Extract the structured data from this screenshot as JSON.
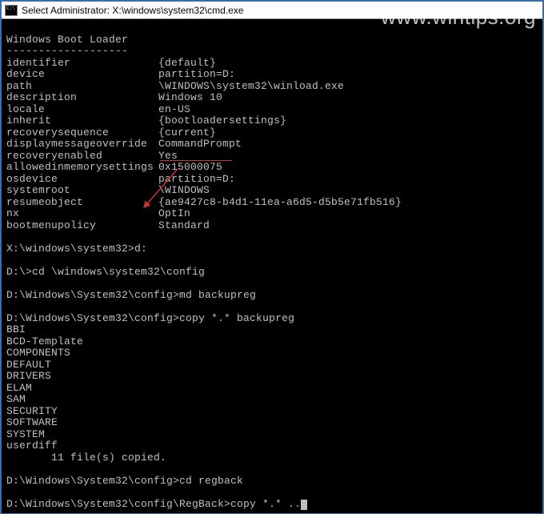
{
  "window": {
    "title": "Select Administrator: X:\\windows\\system32\\cmd.exe"
  },
  "watermark": "www.wintips.org",
  "terminal": {
    "header": "Windows Boot Loader",
    "divider": "-------------------",
    "entries": [
      {
        "label": "identifier",
        "value": "{default}"
      },
      {
        "label": "device",
        "value": "partition=D:"
      },
      {
        "label": "path",
        "value": "\\WINDOWS\\system32\\winload.exe"
      },
      {
        "label": "description",
        "value": "Windows 10"
      },
      {
        "label": "locale",
        "value": "en-US"
      },
      {
        "label": "inherit",
        "value": "{bootloadersettings}"
      },
      {
        "label": "recoverysequence",
        "value": "{current}"
      },
      {
        "label": "displaymessageoverride",
        "value": "CommandPrompt"
      },
      {
        "label": "recoveryenabled",
        "value": "Yes"
      },
      {
        "label": "allowedinmemorysettings",
        "value": "0x15000075"
      },
      {
        "label": "osdevice",
        "value": "partition=D:"
      },
      {
        "label": "systemroot",
        "value": "\\WINDOWS"
      },
      {
        "label": "resumeobject",
        "value": "{ae9427c8-b4d1-11ea-a6d5-d5b5e71fb516}"
      },
      {
        "label": "nx",
        "value": "OptIn"
      },
      {
        "label": "bootmenupolicy",
        "value": "Standard"
      }
    ],
    "prompt1_prefix": "X:\\windows\\system32>",
    "prompt1_cmd": "d:",
    "prompt2_prefix": "D:\\>",
    "prompt2_cmd": "cd \\windows\\system32\\config",
    "prompt3_prefix": "D:\\Windows\\System32\\config>",
    "prompt3_cmd": "md backupreg",
    "prompt4_prefix": "D:\\Windows\\System32\\config>",
    "prompt4_cmd": "copy *.* backupreg",
    "copy_list": [
      "BBI",
      "BCD-Template",
      "COMPONENTS",
      "DEFAULT",
      "DRIVERS",
      "ELAM",
      "SAM",
      "SECURITY",
      "SOFTWARE",
      "SYSTEM",
      "userdiff"
    ],
    "copy_result": "       11 file(s) copied.",
    "prompt5_prefix": "D:\\Windows\\System32\\config>",
    "prompt5_cmd": "cd regback",
    "prompt6_prefix": "D:\\Windows\\System32\\config\\RegBack>",
    "prompt6_cmd": "copy *.* .."
  }
}
